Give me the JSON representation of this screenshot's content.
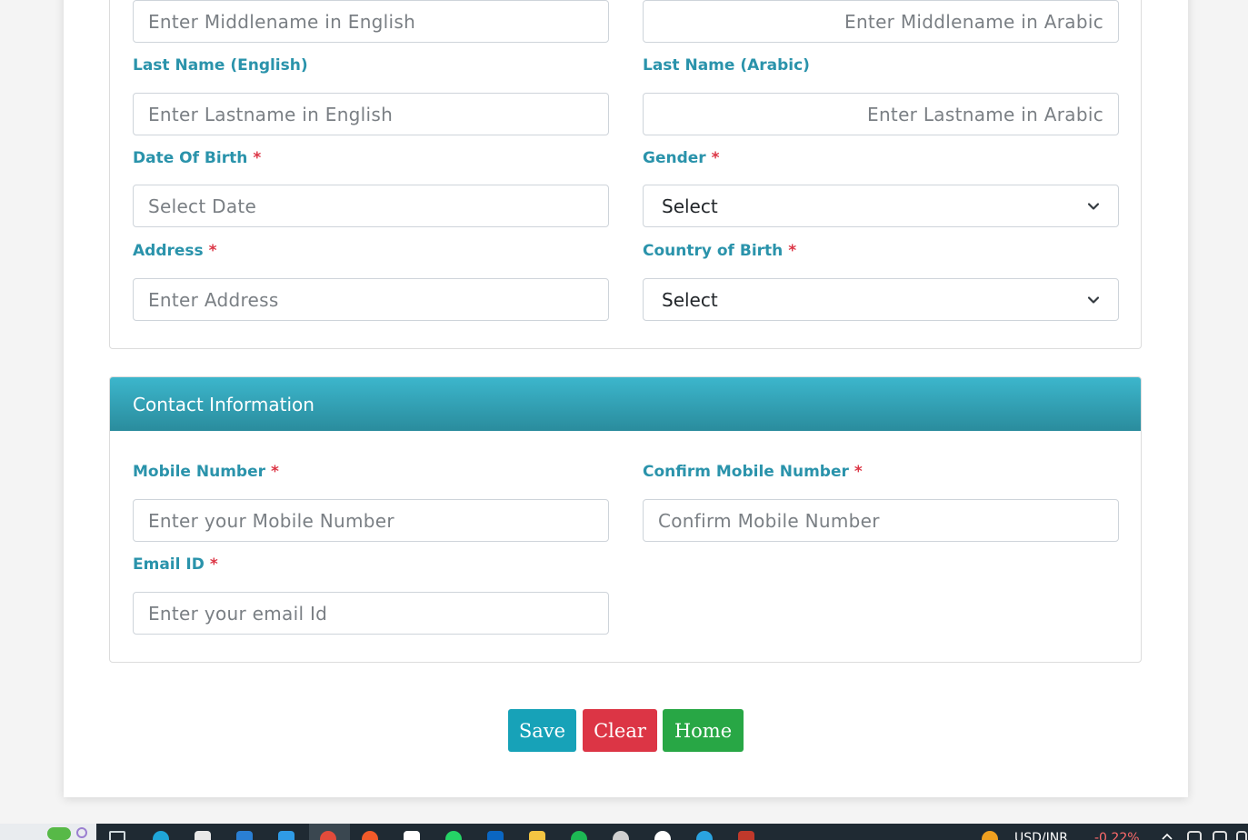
{
  "personal": {
    "middlename_en_placeholder": "Enter Middlename in English",
    "middlename_ar_placeholder": "Enter Middlename in Arabic",
    "lastname_en_label": "Last Name (English)",
    "lastname_ar_label": "Last Name (Arabic)",
    "lastname_en_placeholder": "Enter Lastname in English",
    "lastname_ar_placeholder": "Enter Lastname in Arabic",
    "dob_label": "Date Of Birth",
    "dob_placeholder": "Select Date",
    "gender_label": "Gender",
    "gender_value": "Select",
    "address_label": "Address",
    "address_placeholder": "Enter Address",
    "country_label": "Country of Birth",
    "country_value": "Select"
  },
  "contact": {
    "title": "Contact Information",
    "mobile_label": "Mobile Number",
    "mobile_placeholder": "Enter your Mobile Number",
    "confirm_mobile_label": "Confirm Mobile Number",
    "confirm_mobile_placeholder": "Confirm Mobile Number",
    "email_label": "Email ID",
    "email_placeholder": "Enter your email Id"
  },
  "required_mark": "*",
  "actions": {
    "save": "Save",
    "clear": "Clear",
    "home": "Home"
  },
  "taskbar": {
    "currency_label": "USD/INR",
    "currency_change": "-0.22%"
  },
  "colors": {
    "label": "#2a93ab",
    "required": "#dc3545",
    "header_top": "#3cb6cc",
    "header_bottom": "#2a8c9d",
    "save": "#17a2b8",
    "clear": "#dc3545",
    "home": "#28a745"
  }
}
